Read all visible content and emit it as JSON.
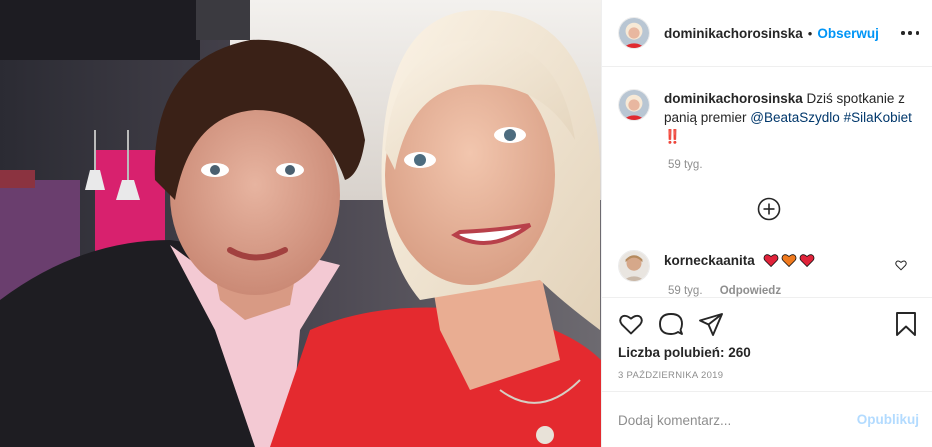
{
  "header": {
    "username": "dominikachorosinska",
    "separator": "•",
    "follow_label": "Obserwuj"
  },
  "caption": {
    "username": "dominikachorosinska",
    "text_before": " Dziś spotkanie z panią premier ",
    "mention": "@BeataSzydlo",
    "hashtag": "#SilaKobiet",
    "text_after": " ‼️",
    "time": "59 tyg."
  },
  "comment": {
    "username": "korneckaanita",
    "emoji_hearts": [
      "red-heart",
      "orange-heart",
      "red-heart"
    ],
    "time": "59 tyg.",
    "reply_label": "Odpowiedz"
  },
  "likes": {
    "text": "Liczba polubień: 260"
  },
  "date": {
    "text": "3 PAŹDZIERNIKA 2019"
  },
  "add_comment": {
    "placeholder": "Dodaj komentarz...",
    "post_label": "Opublikuj"
  },
  "colors": {
    "link_blue": "#0095f6",
    "mention_blue": "#00376b",
    "muted": "#8e8e8e",
    "post_disabled": "#b3dbff",
    "heart_red": "#e0233a",
    "heart_orange": "#f07a1e"
  }
}
